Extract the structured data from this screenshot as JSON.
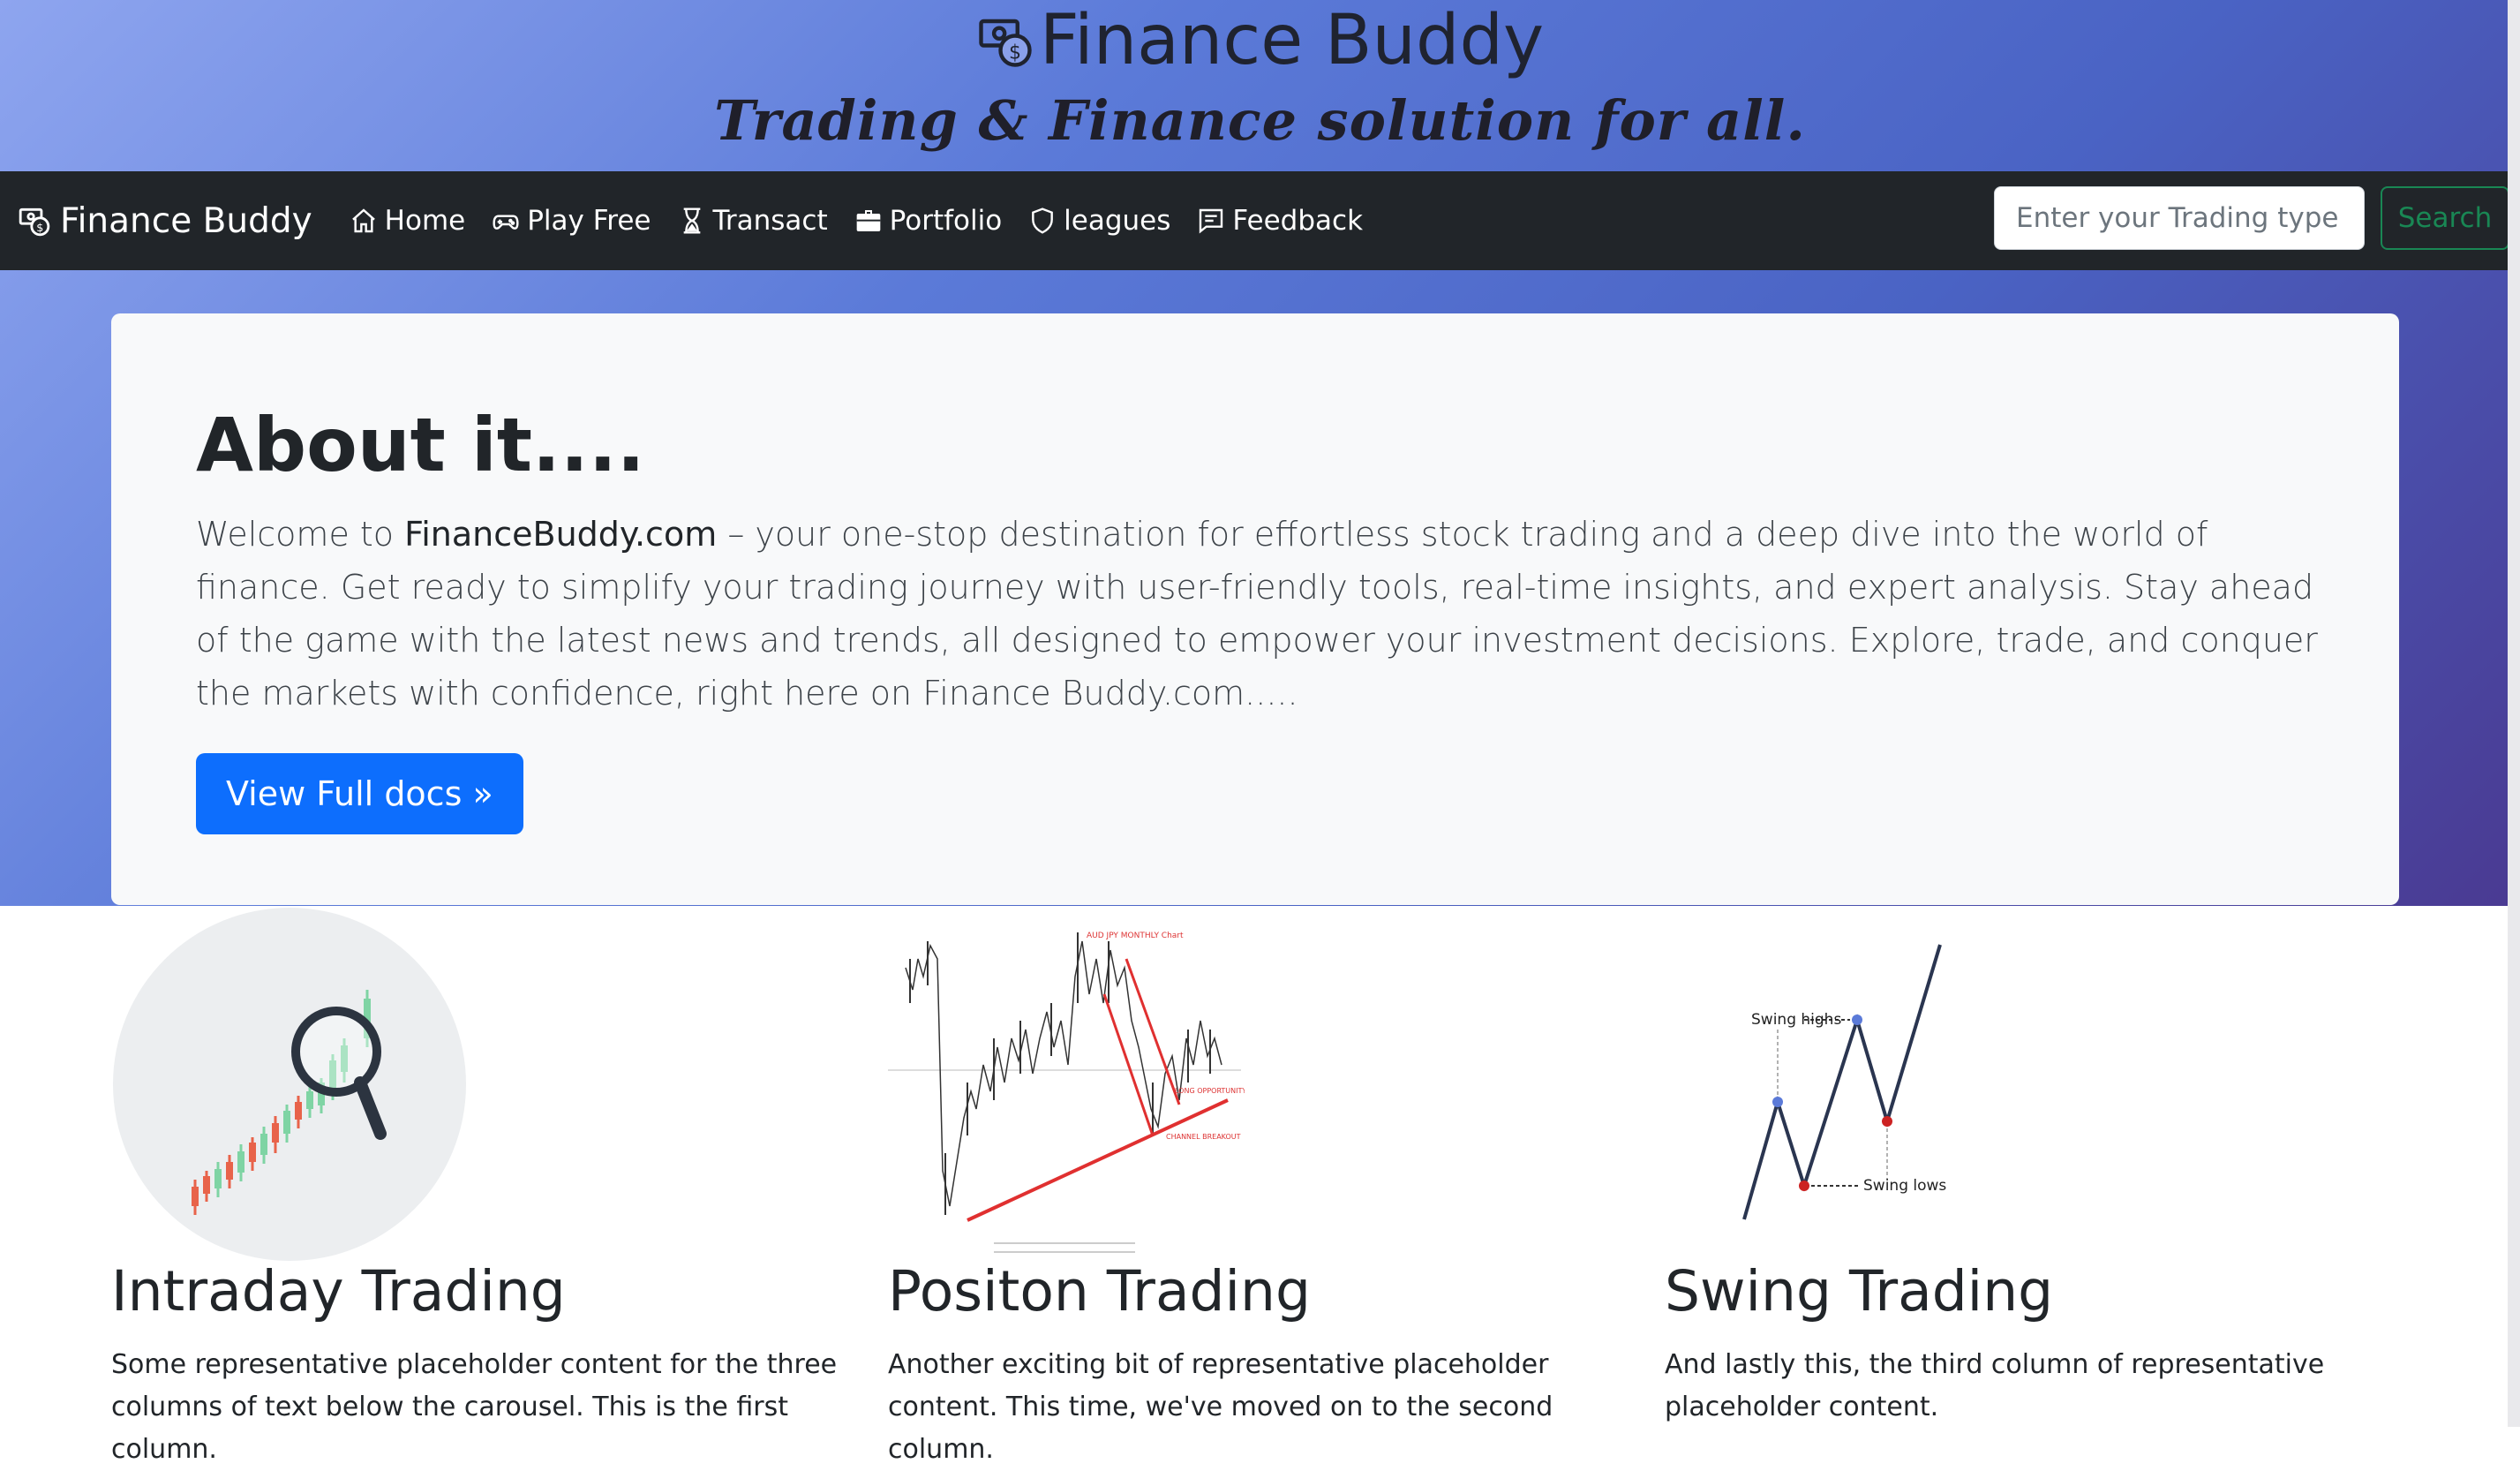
{
  "header": {
    "site_title": "Finance Buddy",
    "tagline": "Trading & Finance solution for all."
  },
  "navbar": {
    "brand": "Finance Buddy",
    "items": [
      {
        "label": "Home",
        "icon": "home-icon"
      },
      {
        "label": "Play Free",
        "icon": "gamepad-icon"
      },
      {
        "label": "Transact",
        "icon": "hourglass-icon"
      },
      {
        "label": "Portfolio",
        "icon": "briefcase-icon"
      },
      {
        "label": "leagues",
        "icon": "shield-icon"
      },
      {
        "label": "Feedback",
        "icon": "feedback-icon"
      }
    ],
    "search_placeholder": "Enter your Trading type",
    "search_button": "Search"
  },
  "about": {
    "title": "About it....",
    "text_pre": "Welcome to ",
    "text_strong": "FinanceBuddy.com",
    "text_post": " – your one-stop destination for effortless stock trading and a deep dive into the world of finance. Get ready to simplify your trading journey with user-friendly tools, real-time insights, and expert analysis. Stay ahead of the game with the latest news and trends, all designed to empower your investment decisions. Explore, trade, and conquer the markets with confidence, right here on Finance Buddy.com.....",
    "button": "View Full docs »"
  },
  "columns": [
    {
      "title": "Intraday Trading",
      "text": "Some representative placeholder content for the three columns of text below the carousel. This is the first column."
    },
    {
      "title": "Positon Trading",
      "text": "Another exciting bit of representative placeholder content. This time, we've moved on to the second column."
    },
    {
      "title": "Swing Trading",
      "text": "And lastly this, the third column of representative placeholder content."
    }
  ],
  "chart_labels": {
    "position_title": "AUD JPY MONTHLY Chart",
    "position_long": "LONG OPPORTUNITY",
    "position_breakout": "CHANNEL BREAKOUT",
    "swing_highs": "Swing highs",
    "swing_lows": "Swing lows"
  },
  "colors": {
    "navbar_bg": "#212529",
    "primary_button": "#0d6efd",
    "search_button": "#198754",
    "card_bg": "#f8f9fa"
  }
}
